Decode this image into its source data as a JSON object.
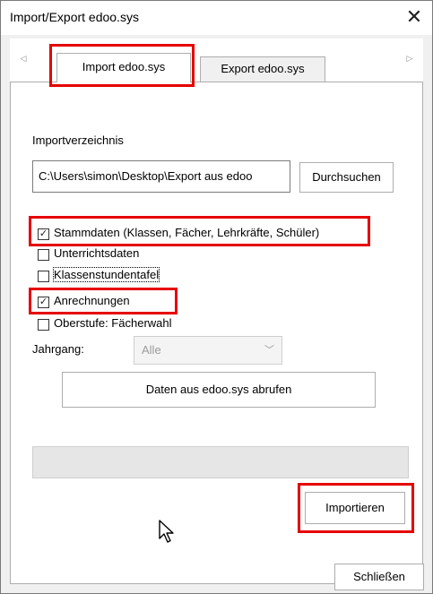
{
  "window": {
    "title": "Import/Export edoo.sys",
    "close_glyph": "✕"
  },
  "tabs": {
    "scroll_left": "◁",
    "scroll_right": "▷",
    "import_label": "Import edoo.sys",
    "export_label": "Export edoo.sys"
  },
  "import": {
    "dir_label": "Importverzeichnis",
    "dir_value": "C:\\Users\\simon\\Desktop\\Export aus edoo",
    "browse_label": "Durchsuchen",
    "options": [
      {
        "label": "Stammdaten (Klassen, Fächer, Lehrkräfte, Schüler)",
        "checked": true
      },
      {
        "label": "Unterrichtsdaten",
        "checked": false
      },
      {
        "label": "Klassenstundentafel",
        "checked": false
      },
      {
        "label": "Anrechnungen",
        "checked": true
      },
      {
        "label": "Oberstufe: Fächerwahl",
        "checked": false
      }
    ],
    "jahrgang_label": "Jahrgang:",
    "jahrgang_value": "Alle",
    "fetch_label": "Daten aus edoo.sys abrufen",
    "progress": 0,
    "import_button": "Importieren"
  },
  "footer": {
    "close_button": "Schließen"
  },
  "colors": {
    "highlight": "#e60000"
  }
}
